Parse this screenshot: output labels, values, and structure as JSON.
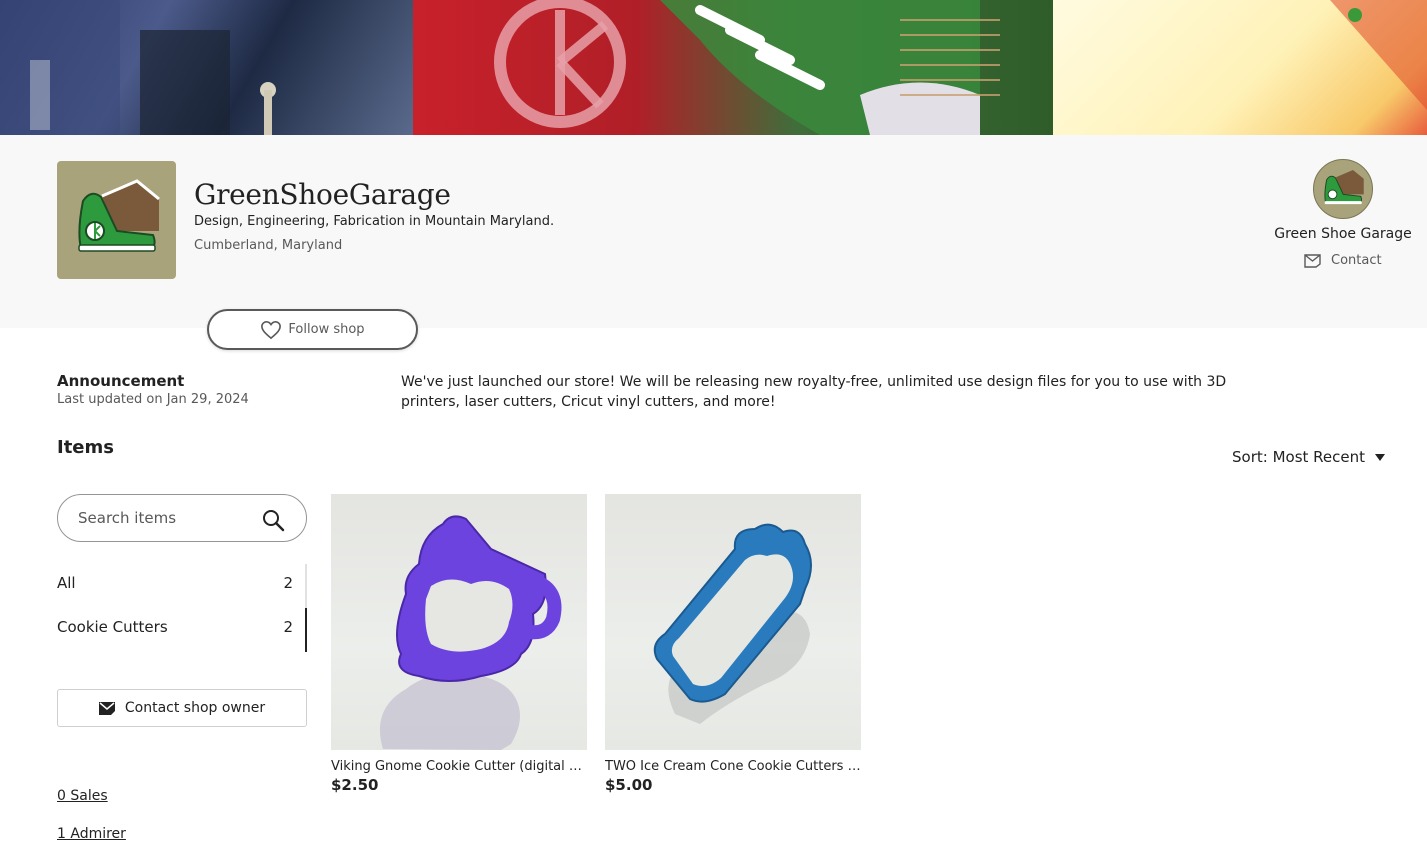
{
  "shop": {
    "name": "GreenShoeGarage",
    "tagline": "Design, Engineering, Fabrication in Mountain Maryland.",
    "location": "Cumberland, Maryland",
    "follow_label": "Follow shop"
  },
  "owner": {
    "name": "Green Shoe Garage",
    "contact_label": "Contact"
  },
  "announcement": {
    "title": "Announcement",
    "updated": "Last updated on Jan 29, 2024",
    "text": "We've just launched our store! We will be releasing new royalty-free, unlimited use design files for you to use with 3D printers, laser cutters, Cricut vinyl cutters, and more!"
  },
  "items": {
    "title": "Items",
    "sort_label": "Sort: Most Recent"
  },
  "sidebar": {
    "search_placeholder": "Search items",
    "categories": [
      {
        "label": "All",
        "count": "2"
      },
      {
        "label": "Cookie Cutters",
        "count": "2"
      }
    ],
    "contact_owner_label": "Contact shop owner",
    "sales": "0 Sales",
    "admirers": "1 Admirer"
  },
  "listings": [
    {
      "title": "Viking Gnome Cookie Cutter (digital file)",
      "price": "$2.50",
      "color": "#7b52e8"
    },
    {
      "title": "TWO Ice Cream Cone Cookie Cutters (digital file)",
      "price": "$5.00",
      "color": "#2f7fb8"
    }
  ]
}
